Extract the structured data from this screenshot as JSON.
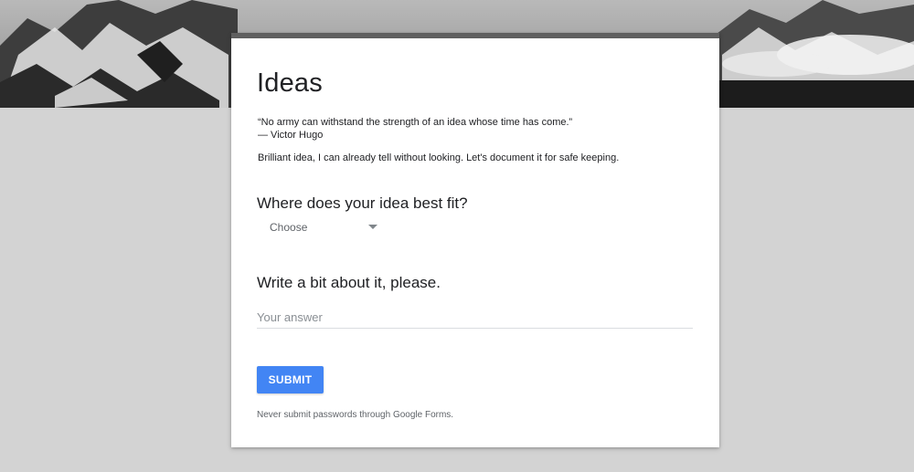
{
  "theme": {
    "accent": "#4285f4",
    "page_background": "#d3d3d3",
    "card_background": "#ffffff"
  },
  "form": {
    "title": "Ideas",
    "quote_line_1": "“No army can withstand the strength of an idea whose time has come.”",
    "quote_line_2": "— Victor Hugo",
    "description": "Brilliant idea, I can already tell without looking. Let's document it for safe keeping."
  },
  "questions": [
    {
      "title": "Where does your idea best fit?",
      "type": "dropdown",
      "selected": "Choose",
      "icon": "caret-down-icon"
    },
    {
      "title": "Write a bit about it, please.",
      "type": "short-answer",
      "value": "",
      "placeholder": "Your answer"
    }
  ],
  "submit": {
    "label": "SUBMIT"
  },
  "footer": {
    "note": "Never submit passwords through Google Forms."
  }
}
